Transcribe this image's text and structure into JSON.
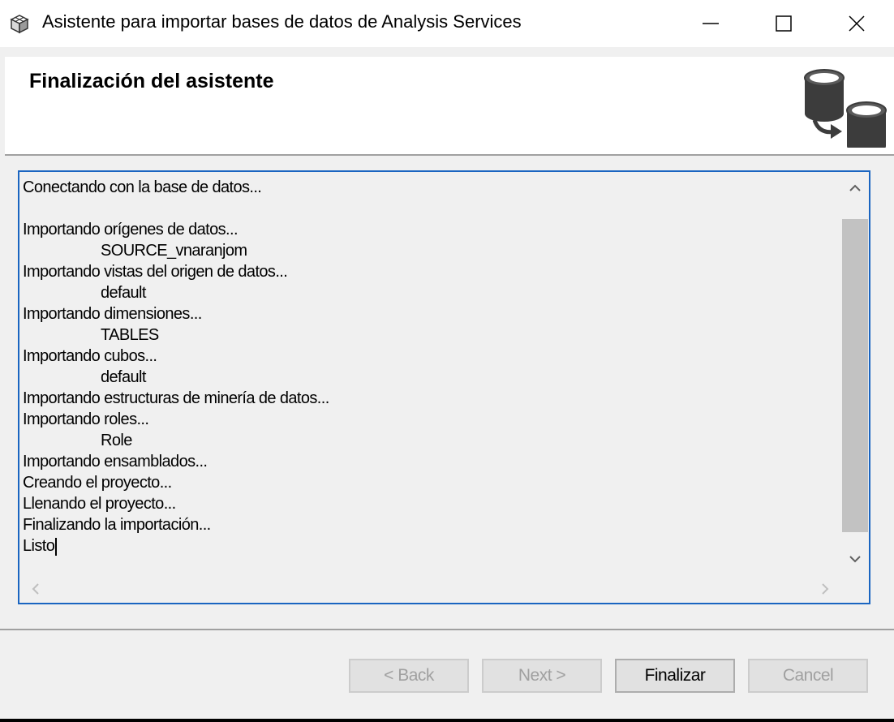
{
  "window": {
    "title": "Asistente para importar bases de datos de Analysis Services"
  },
  "header": {
    "title": "Finalización del asistente"
  },
  "log": {
    "lines": [
      {
        "text": "Conectando con la base de datos...",
        "indent": false
      },
      {
        "text": "",
        "indent": false
      },
      {
        "text": "Importando orígenes de datos...",
        "indent": false
      },
      {
        "text": "SOURCE_vnaranjom",
        "indent": true
      },
      {
        "text": "Importando vistas del origen de datos...",
        "indent": false
      },
      {
        "text": "default",
        "indent": true
      },
      {
        "text": "Importando dimensiones...",
        "indent": false
      },
      {
        "text": "TABLES",
        "indent": true
      },
      {
        "text": "Importando cubos...",
        "indent": false
      },
      {
        "text": "default",
        "indent": true
      },
      {
        "text": "Importando estructuras de minería de datos...",
        "indent": false
      },
      {
        "text": "Importando roles...",
        "indent": false
      },
      {
        "text": "Role",
        "indent": true
      },
      {
        "text": "Importando ensamblados...",
        "indent": false
      },
      {
        "text": "Creando el proyecto...",
        "indent": false
      },
      {
        "text": "Llenando el proyecto...",
        "indent": false
      },
      {
        "text": "Finalizando la importación...",
        "indent": false
      },
      {
        "text": "Listo",
        "indent": false
      }
    ]
  },
  "buttons": {
    "back": "< Back",
    "next": "Next >",
    "finish": "Finalizar",
    "cancel": "Cancel"
  },
  "icons": {
    "app": "cube-icon",
    "header": "database-import-icon",
    "minimize": "minimize-icon",
    "maximize": "maximize-icon",
    "close": "close-icon"
  },
  "colors": {
    "focus_border": "#1a65c1",
    "background": "#f0f0f0"
  }
}
